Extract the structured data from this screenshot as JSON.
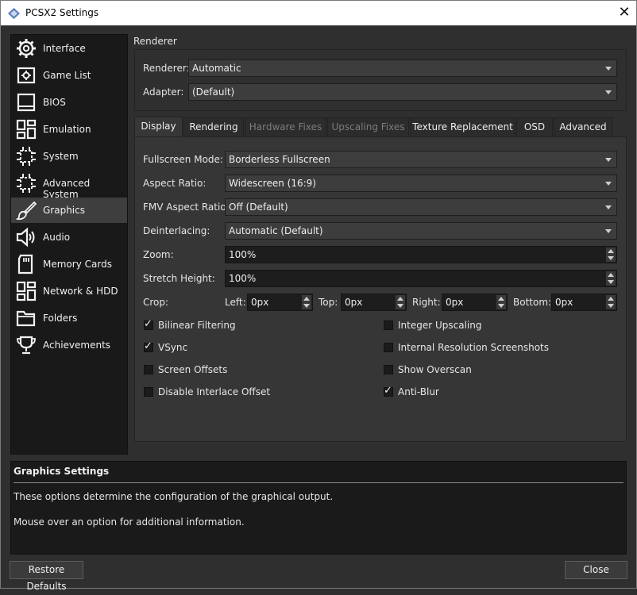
{
  "window": {
    "title": "PCSX2 Settings",
    "close_glyph": "✕"
  },
  "sidebar": {
    "items": [
      {
        "label": "Interface",
        "icon": "gear-icon"
      },
      {
        "label": "Game List",
        "icon": "game-list-icon"
      },
      {
        "label": "BIOS",
        "icon": "chip-icon"
      },
      {
        "label": "Emulation",
        "icon": "emulation-icon"
      },
      {
        "label": "System",
        "icon": "cpu-icon"
      },
      {
        "label": "Advanced System",
        "icon": "cpu-advanced-icon"
      },
      {
        "label": "Graphics",
        "icon": "brush-icon",
        "selected": true
      },
      {
        "label": "Audio",
        "icon": "speaker-icon"
      },
      {
        "label": "Memory Cards",
        "icon": "memory-card-icon"
      },
      {
        "label": "Network & HDD",
        "icon": "network-icon"
      },
      {
        "label": "Folders",
        "icon": "folder-icon"
      },
      {
        "label": "Achievements",
        "icon": "trophy-icon"
      }
    ]
  },
  "renderer_group": {
    "title": "Renderer",
    "renderer_label": "Renderer:",
    "renderer_value": "Automatic",
    "adapter_label": "Adapter:",
    "adapter_value": "(Default)"
  },
  "tabs": [
    {
      "label": "Display",
      "active": true
    },
    {
      "label": "Rendering"
    },
    {
      "label": "Hardware Fixes",
      "disabled": true
    },
    {
      "label": "Upscaling Fixes",
      "disabled": true
    },
    {
      "label": "Texture Replacement"
    },
    {
      "label": "OSD"
    },
    {
      "label": "Advanced"
    }
  ],
  "display": {
    "fullscreen_label": "Fullscreen Mode:",
    "fullscreen_value": "Borderless Fullscreen",
    "aspect_label": "Aspect Ratio:",
    "aspect_value": "Widescreen (16:9)",
    "fmv_label": "FMV Aspect Ratio:",
    "fmv_value": "Off (Default)",
    "deinterlace_label": "Deinterlacing:",
    "deinterlace_value": "Automatic (Default)",
    "zoom_label": "Zoom:",
    "zoom_value": "100%",
    "stretch_label": "Stretch Height:",
    "stretch_value": "100%",
    "crop": {
      "label": "Crop:",
      "left_label": "Left:",
      "left_value": "0px",
      "top_label": "Top:",
      "top_value": "0px",
      "right_label": "Right:",
      "right_value": "0px",
      "bottom_label": "Bottom:",
      "bottom_value": "0px"
    },
    "checkboxes": {
      "bilinear": {
        "label": "Bilinear Filtering",
        "checked": true
      },
      "integer": {
        "label": "Integer Upscaling",
        "checked": false
      },
      "vsync": {
        "label": "VSync",
        "checked": true
      },
      "internal_res": {
        "label": "Internal Resolution Screenshots",
        "checked": false
      },
      "screen_offsets": {
        "label": "Screen Offsets",
        "checked": false
      },
      "show_overscan": {
        "label": "Show Overscan",
        "checked": false
      },
      "disable_interlace": {
        "label": "Disable Interlace Offset",
        "checked": false
      },
      "anti_blur": {
        "label": "Anti-Blur",
        "checked": true
      }
    },
    "check_glyph": "✓"
  },
  "info": {
    "title": "Graphics Settings",
    "line1": "These options determine the configuration of the graphical output.",
    "line2": "Mouse over an option for additional information."
  },
  "buttons": {
    "restore": "Restore Defaults",
    "close": "Close"
  }
}
